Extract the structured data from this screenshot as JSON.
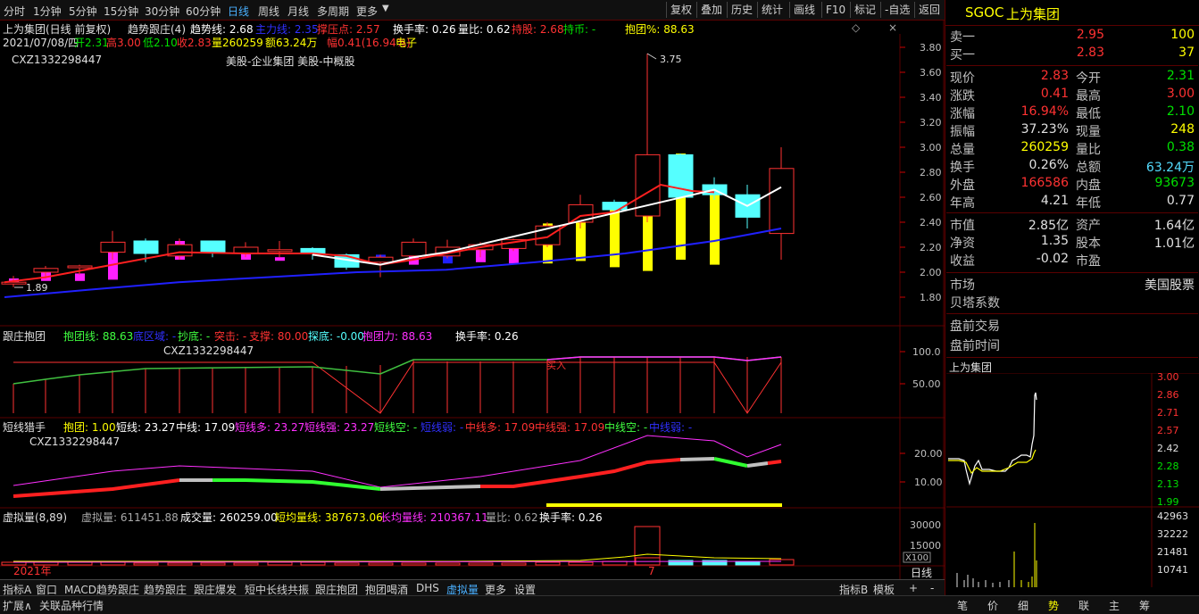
{
  "toolbar": {
    "periods": [
      "分时",
      "1分钟",
      "5分钟",
      "15分钟",
      "30分钟",
      "60分钟",
      "日线",
      "周线",
      "月线",
      "多周期",
      "更多"
    ],
    "active_period": "日线",
    "right_buttons": [
      "复权",
      "叠加",
      "历史",
      "统计",
      "画线",
      "F10",
      "标记",
      "-自选",
      "返回"
    ]
  },
  "header": {
    "name_mode": "上为集团(日线 前复权)",
    "indicator_name": "趋势跟庄(4)",
    "trend_line": "趋势线: 2.68",
    "main_line": "主力线: 2.35",
    "pressure": "撑压点: 2.57",
    "turnover": "换手率: 0.26",
    "volume_ratio": "量比: 0.62",
    "hold": "持股: 2.68",
    "hold_coin": "持币: -",
    "embrace_pct": "抱团%: 88.63",
    "date_line": "2021/07/08/四",
    "open": "开2.31",
    "high": "高3.00",
    "low": "低2.10",
    "close": "收2.83",
    "vol": "量260259",
    "amount": "额63.24万",
    "amp": "幅0.41(16.94%)",
    "sector": "电子",
    "watermark": "CXZ1332298447",
    "tags": "美股-企业集团 美股-中概股",
    "peak_label": "3.75",
    "low_label": "1.89"
  },
  "main_axis": [
    "3.80",
    "3.60",
    "3.40",
    "3.20",
    "3.00",
    "2.80",
    "2.60",
    "2.40",
    "2.20",
    "2.00",
    "1.80"
  ],
  "panel2": {
    "title": "跟庄抱团",
    "line": "抱团线: 88.63",
    "bottom_zone": "底区域: -",
    "bottom": "抄底: -",
    "breakout": "突击: -",
    "support": "支撑: 80.00",
    "probe": "探底: -0.00",
    "power": "抱团力: 88.63",
    "turnover": "换手率: 0.26",
    "watermark": "CXZ1332298447",
    "buy_label": "买入",
    "axis": [
      "100.0",
      "50.00"
    ]
  },
  "panel3": {
    "title": "短线猎手",
    "embrace": "抱团: 1.00",
    "short": "短线: 23.27",
    "mid": "中线: 17.09",
    "short_long": "短线多: 23.27",
    "short_strong": "短线强: 23.27",
    "short_empty": "短线空: -",
    "short_weak": "短线弱: -",
    "mid_long": "中线多: 17.09",
    "mid_strong": "中线强: 17.09",
    "mid_empty": "中线空: -",
    "mid_weak": "中线弱: -",
    "watermark": "CXZ1332298447",
    "axis": [
      "20.00",
      "10.00"
    ]
  },
  "panel4": {
    "title": "虚拟量(8,89)",
    "virtual": "虚拟量: 611451.88",
    "deal": "成交量: 260259.00",
    "short_avg": "短均量线: 387673.06",
    "long_avg": "长均量线: 210367.11",
    "ratio": "量比: 0.62",
    "turnover": "换手率: 0.26",
    "axis": [
      "30000",
      "15000"
    ],
    "unit": "X100"
  },
  "year_label": "2021年",
  "month_label": "7",
  "period_label": "日线",
  "bottom_tabs": [
    "指标A",
    "窗口",
    "MACD趋势跟庄",
    "趋势跟庄",
    "跟庄爆发",
    "短中长线共振",
    "跟庄抱团",
    "抱团喝酒",
    "DHS",
    "虚拟量",
    "更多",
    "设置"
  ],
  "bottom_right": [
    "指标B",
    "模板",
    "+",
    "-"
  ],
  "status_left": [
    "扩展∧",
    "关联品种行情"
  ],
  "status_right": [
    "笔",
    "价",
    "细",
    "势",
    "联",
    "主",
    "筹"
  ],
  "quote": {
    "code": "SGOC",
    "name": "上为集团",
    "sell1_label": "卖一",
    "sell1_price": "2.95",
    "sell1_vol": "100",
    "buy1_label": "买一",
    "buy1_price": "2.83",
    "buy1_vol": "37",
    "rows": [
      {
        "l1": "现价",
        "v1": "2.83",
        "c1": "#ff3232",
        "l2": "今开",
        "v2": "2.31",
        "c2": "#00e000"
      },
      {
        "l1": "涨跌",
        "v1": "0.41",
        "c1": "#ff3232",
        "l2": "最高",
        "v2": "3.00",
        "c2": "#ff3232"
      },
      {
        "l1": "涨幅",
        "v1": "16.94%",
        "c1": "#ff3232",
        "l2": "最低",
        "v2": "2.10",
        "c2": "#00e000"
      },
      {
        "l1": "振幅",
        "v1": "37.23%",
        "c1": "#e0e0e0",
        "l2": "现量",
        "v2": "248",
        "c2": "#ffff00"
      },
      {
        "l1": "总量",
        "v1": "260259",
        "c1": "#ffff00",
        "l2": "量比",
        "v2": "0.38",
        "c2": "#00e000"
      },
      {
        "l1": "换手",
        "v1": "0.26%",
        "c1": "#e0e0e0",
        "l2": "总额",
        "v2": "63.24万",
        "c2": "#55ddff"
      },
      {
        "l1": "外盘",
        "v1": "166586",
        "c1": "#ff3232",
        "l2": "内盘",
        "v2": "93673",
        "c2": "#00e000"
      },
      {
        "l1": "年高",
        "v1": "4.21",
        "c1": "#e0e0e0",
        "l2": "年低",
        "v2": "0.77",
        "c2": "#e0e0e0"
      }
    ],
    "rows2": [
      {
        "l1": "市值",
        "v1": "2.85亿",
        "l2": "资产",
        "v2": "1.64亿"
      },
      {
        "l1": "净资",
        "v1": "1.35",
        "l2": "股本",
        "v2": "1.01亿"
      },
      {
        "l1": "收益",
        "v1": "-0.02",
        "l2": "市盈",
        "v2": ""
      }
    ],
    "market_label": "市场",
    "market_value": "美国股票",
    "beta_label": "贝塔系数",
    "pre_trade": "盘前交易",
    "pre_time": "盘前时间",
    "mini_title": "上为集团",
    "mini_axis": [
      "3.00",
      "2.86",
      "2.71",
      "2.57",
      "2.42",
      "2.28",
      "2.13",
      "1.99"
    ],
    "mini_vol_axis": [
      "42963",
      "32222",
      "21481",
      "10741"
    ]
  },
  "colors": {
    "red": "#ff3232",
    "green": "#00e000",
    "blue": "#2020ff",
    "cyan": "#55ffff",
    "magenta": "#ff30ff",
    "yellow": "#ffff00"
  }
}
